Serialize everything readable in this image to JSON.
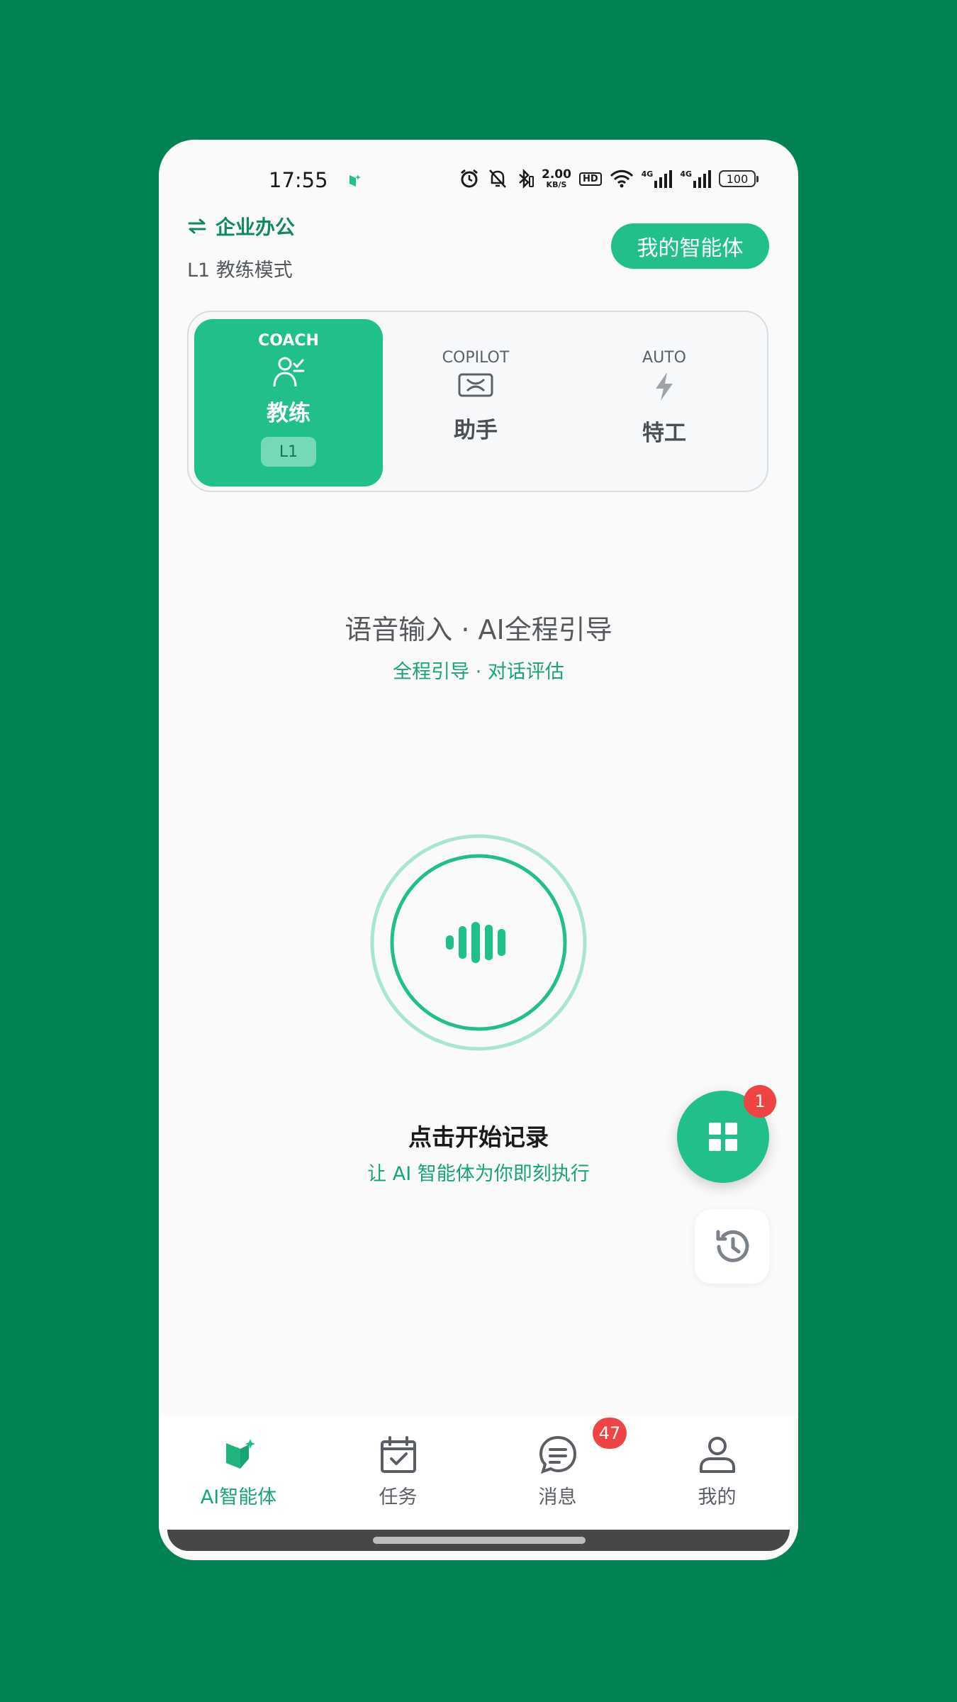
{
  "status_bar": {
    "time": "17:55",
    "speed_value": "2.00",
    "speed_unit": "KB/S",
    "hd_label": "HD",
    "net1": "4G",
    "net2": "4G",
    "battery": "100"
  },
  "header": {
    "switch_label": "企业办公",
    "mode_label": "L1 教练模式",
    "my_agents_button": "我的智能体"
  },
  "modes": [
    {
      "tag": "COACH",
      "name": "教练",
      "level": "L1",
      "active": true,
      "icon": "coach-person-icon"
    },
    {
      "tag": "COPILOT",
      "name": "助手",
      "active": false,
      "icon": "copilot-ticket-icon"
    },
    {
      "tag": "AUTO",
      "name": "特工",
      "active": false,
      "icon": "lightning-icon"
    }
  ],
  "voice": {
    "title": "语音输入 · AI全程引导",
    "subtitle": "全程引导 · 对话评估"
  },
  "record": {
    "title": "点击开始记录",
    "subtitle": "让 AI 智能体为你即刻执行"
  },
  "floating": {
    "apps_badge": "1"
  },
  "nav": [
    {
      "label": "AI智能体",
      "active": true,
      "icon": "ai-agent-icon"
    },
    {
      "label": "任务",
      "active": false,
      "icon": "calendar-check-icon"
    },
    {
      "label": "消息",
      "active": false,
      "icon": "chat-bubble-icon",
      "badge": "47"
    },
    {
      "label": "我的",
      "active": false,
      "icon": "user-icon"
    }
  ],
  "colors": {
    "background": "#008253",
    "accent": "#21c08a",
    "accent_text": "#17a673",
    "badge": "#ef4444"
  }
}
